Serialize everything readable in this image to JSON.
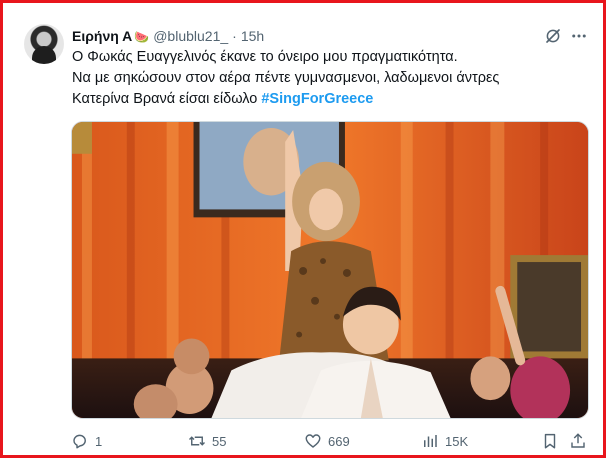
{
  "tweet": {
    "author": {
      "name": "Ειρήνη Α",
      "emoji": "🍉",
      "handle": "@blublu21_",
      "separator": "·",
      "time": "15h"
    },
    "text": {
      "line1": "Ο Φωκάς Ευαγγελινός έκανε το όνειρο μου πραγματικότητα.",
      "line2": "Να με σηκώσουν στον αέρα πέντε γυμνασμενοι, λαδωμενοι άντρες",
      "line3_prefix": "Κατερίνα Βρανά είσαι είδωλο ",
      "hashtag": "#SingForGreece"
    },
    "media": {
      "icon": "photo-stage-performance"
    },
    "actions": {
      "replies": "1",
      "reposts": "55",
      "likes": "669",
      "views": "15K"
    }
  },
  "colors": {
    "frame": "#e8151c",
    "hashtag": "#1d9bf0",
    "secondary": "#536471",
    "primary_text": "#0f1419"
  }
}
